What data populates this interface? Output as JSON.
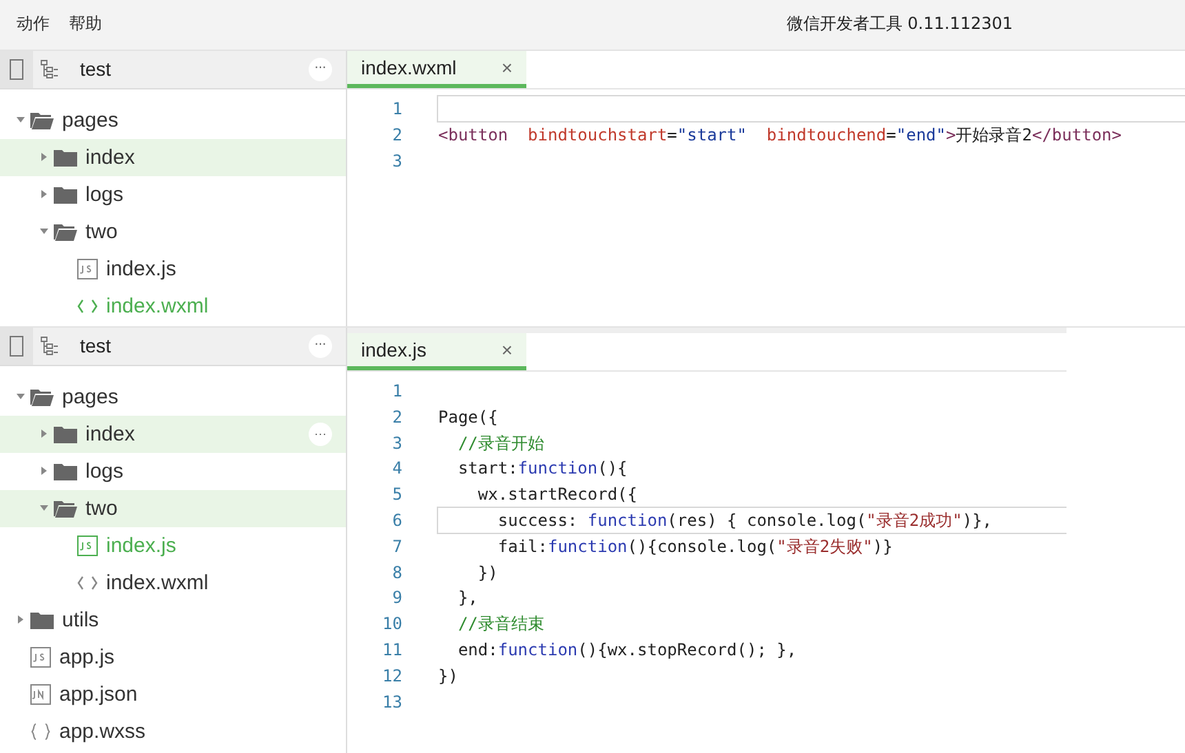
{
  "menu": [
    "动作",
    "帮助"
  ],
  "app_title": "微信开发者工具 0.11.112301",
  "panels": [
    {
      "project": "test",
      "more": "···",
      "tree": [
        {
          "name": "pages",
          "kind": "folder",
          "expanded": true,
          "selected": false,
          "active": false,
          "children": [
            {
              "name": "index",
              "kind": "folder",
              "expanded": false,
              "selected": true,
              "active": false
            },
            {
              "name": "logs",
              "kind": "folder",
              "expanded": false,
              "selected": false,
              "active": false
            },
            {
              "name": "two",
              "kind": "folder",
              "expanded": true,
              "selected": false,
              "active": false,
              "children": [
                {
                  "name": "index.js",
                  "kind": "js",
                  "selected": false,
                  "active": false
                },
                {
                  "name": "index.wxml",
                  "kind": "wxml",
                  "selected": false,
                  "active": true
                }
              ]
            }
          ]
        }
      ],
      "tab": {
        "label": "index.wxml",
        "close": "×"
      },
      "code": [
        {
          "number": "1",
          "current": true
        },
        {
          "number": "2",
          "current": false,
          "tokens": [
            {
              "kind": "tag",
              "text": "<button"
            },
            {
              "kind": "attr",
              "text": "  bindtouchstart"
            },
            {
              "kind": "plain",
              "text": "="
            },
            {
              "kind": "string",
              "text": "\"start\""
            },
            {
              "kind": "attr",
              "text": "  bindtouchend"
            },
            {
              "kind": "plain",
              "text": "="
            },
            {
              "kind": "string",
              "text": "\"end\""
            },
            {
              "kind": "tag",
              "text": ">"
            },
            {
              "kind": "plain",
              "text": "开始录音2"
            },
            {
              "kind": "tag",
              "text": "</button>"
            }
          ]
        },
        {
          "number": "3",
          "current": false
        }
      ]
    },
    {
      "project": "test",
      "more": "···",
      "tree": [
        {
          "name": "pages",
          "kind": "folder",
          "expanded": true,
          "selected": false,
          "active": false,
          "children": [
            {
              "name": "index",
              "kind": "folder",
              "expanded": false,
              "selected": true,
              "active": false,
              "more": "···"
            },
            {
              "name": "logs",
              "kind": "folder",
              "expanded": false,
              "selected": false,
              "active": false
            },
            {
              "name": "two",
              "kind": "folder",
              "expanded": true,
              "selected": true,
              "active": false,
              "children": [
                {
                  "name": "index.js",
                  "kind": "js",
                  "selected": false,
                  "active": true
                },
                {
                  "name": "index.wxml",
                  "kind": "wxml",
                  "selected": false,
                  "active": false
                }
              ]
            }
          ]
        },
        {
          "name": "utils",
          "kind": "folder",
          "expanded": false,
          "selected": false,
          "active": false
        },
        {
          "name": "app.js",
          "kind": "js",
          "selected": false,
          "active": false
        },
        {
          "name": "app.json",
          "kind": "json",
          "selected": false,
          "active": false
        },
        {
          "name": "app.wxss",
          "kind": "wxss",
          "selected": false,
          "active": false
        }
      ],
      "tab": {
        "label": "index.js",
        "close": "×"
      },
      "code": [
        {
          "number": "1",
          "current": false
        },
        {
          "number": "2",
          "current": false,
          "tokens": [
            {
              "kind": "plain",
              "text": "Page({"
            }
          ]
        },
        {
          "number": "3",
          "current": false,
          "tokens": [
            {
              "kind": "comment",
              "text": "  //录音开始"
            }
          ]
        },
        {
          "number": "4",
          "current": false,
          "tokens": [
            {
              "kind": "plain",
              "text": "  start:"
            },
            {
              "kind": "keyword",
              "text": "function"
            },
            {
              "kind": "plain",
              "text": "(){"
            }
          ]
        },
        {
          "number": "5",
          "current": false,
          "tokens": [
            {
              "kind": "plain",
              "text": "    wx.startRecord({"
            }
          ]
        },
        {
          "number": "6",
          "current": true,
          "tokens": [
            {
              "kind": "plain",
              "text": "      success: "
            },
            {
              "kind": "keyword",
              "text": "function"
            },
            {
              "kind": "plain",
              "text": "(res) { console.log("
            },
            {
              "kind": "string2",
              "text": "\"录音2成功\""
            },
            {
              "kind": "plain",
              "text": ")},"
            }
          ]
        },
        {
          "number": "7",
          "current": false,
          "tokens": [
            {
              "kind": "plain",
              "text": "      fail:"
            },
            {
              "kind": "keyword",
              "text": "function"
            },
            {
              "kind": "plain",
              "text": "(){console.log("
            },
            {
              "kind": "string2",
              "text": "\"录音2失败\""
            },
            {
              "kind": "plain",
              "text": ")}"
            }
          ]
        },
        {
          "number": "8",
          "current": false,
          "tokens": [
            {
              "kind": "plain",
              "text": "    })"
            }
          ]
        },
        {
          "number": "9",
          "current": false,
          "tokens": [
            {
              "kind": "plain",
              "text": "  },"
            }
          ]
        },
        {
          "number": "10",
          "current": false,
          "tokens": [
            {
              "kind": "comment",
              "text": "  //录音结束"
            }
          ]
        },
        {
          "number": "11",
          "current": false,
          "tokens": [
            {
              "kind": "plain",
              "text": "  end:"
            },
            {
              "kind": "keyword",
              "text": "function"
            },
            {
              "kind": "plain",
              "text": "(){wx.stopRecord(); },"
            }
          ]
        },
        {
          "number": "12",
          "current": false,
          "tokens": [
            {
              "kind": "plain",
              "text": "})"
            }
          ]
        },
        {
          "number": "13",
          "current": false
        }
      ]
    }
  ]
}
